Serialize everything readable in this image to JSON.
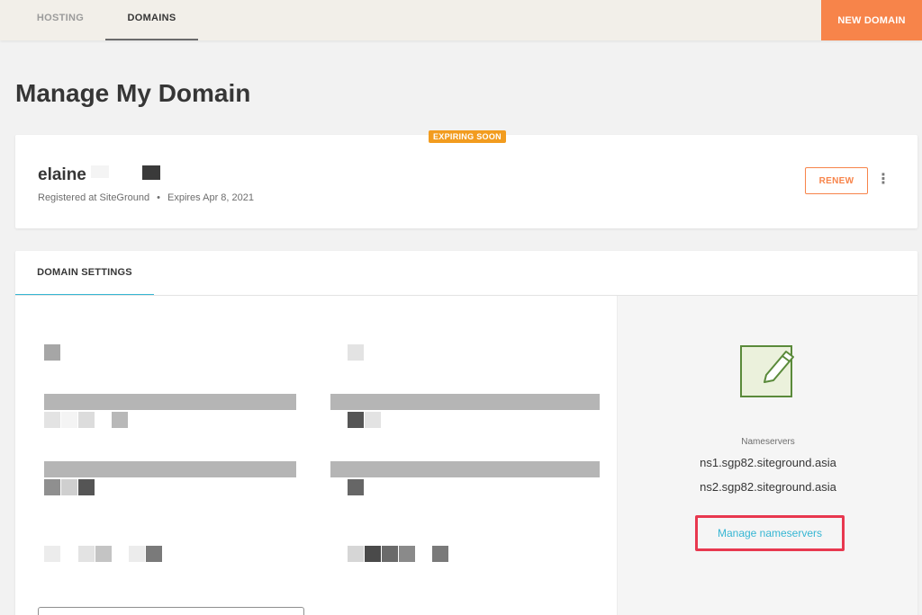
{
  "topbar": {
    "tabs": [
      {
        "label": "HOSTING",
        "active": false
      },
      {
        "label": "DOMAINS",
        "active": true
      }
    ],
    "new_domain_label": "NEW DOMAIN"
  },
  "page_title": "Manage My Domain",
  "domain": {
    "badge": "EXPIRING SOON",
    "name": "elaine",
    "registrar": "Registered at SiteGround",
    "separator": "•",
    "expires": "Expires Apr 8, 2021",
    "renew_label": "RENEW",
    "more_icon": "⋮"
  },
  "settings": {
    "tab_label": "DOMAIN SETTINGS",
    "nameservers": {
      "label": "Nameservers",
      "ns1": "ns1.sgp82.siteground.asia",
      "ns2": "ns2.sgp82.siteground.asia",
      "manage_label": "Manage nameservers"
    }
  },
  "colors": {
    "accent_orange": "#f7844a",
    "badge_orange": "#f29c1f",
    "link_blue": "#36b6d3",
    "highlight_red": "#e8384f",
    "icon_green": "#5a8a3a"
  }
}
